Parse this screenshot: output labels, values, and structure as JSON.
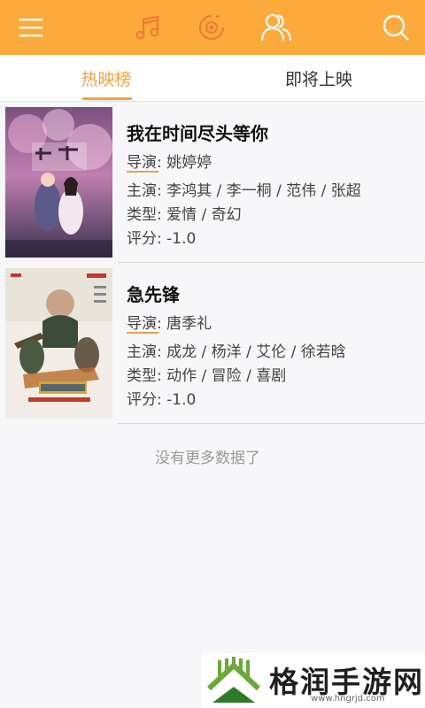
{
  "header": {
    "icons": [
      "menu-icon",
      "music-icon",
      "disc-icon",
      "users-icon",
      "search-icon"
    ],
    "accent_color": "#fcaa3c"
  },
  "tabs": [
    {
      "label": "热映榜",
      "active": true
    },
    {
      "label": "即将上映",
      "active": false
    }
  ],
  "movies": [
    {
      "title": "我在时间尽头等你",
      "director_label": "导演:",
      "director": "姚婷婷",
      "cast_label": "主演:",
      "cast": "李鸿其 / 李一桐 / 范伟 / 张超",
      "genre_label": "类型:",
      "genre": "爱情 / 奇幻",
      "rating_label": "评分:",
      "rating": "-1.0"
    },
    {
      "title": "急先锋",
      "director_label": "导演:",
      "director": "唐季礼",
      "cast_label": "主演:",
      "cast": "成龙 / 杨洋 / 艾伦 / 徐若晗",
      "genre_label": "类型:",
      "genre": "动作 / 冒险 / 喜剧",
      "rating_label": "评分:",
      "rating": "-1.0"
    }
  ],
  "no_more_text": "没有更多数据了",
  "watermark": {
    "brand": "格润手游网",
    "url": "www.hngrjd.com"
  }
}
